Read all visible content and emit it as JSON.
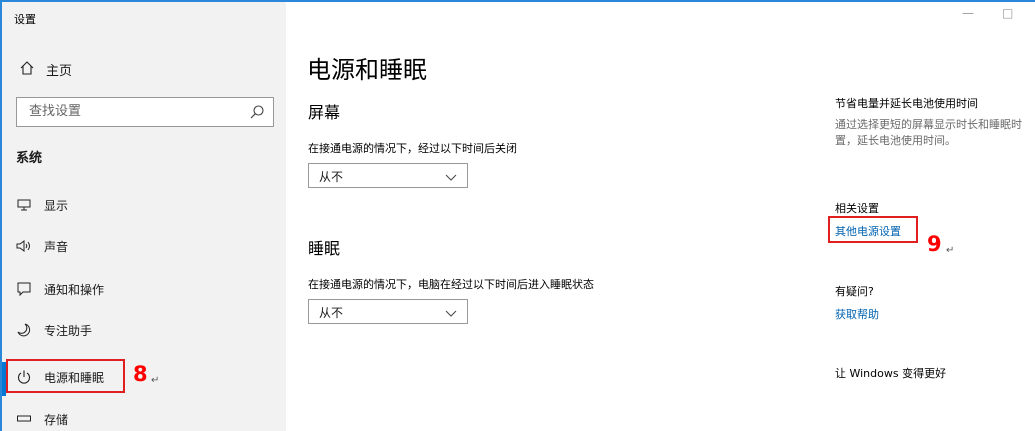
{
  "window": {
    "title": "设置",
    "minimize_glyph": "—",
    "maximize_glyph": "□"
  },
  "sidebar": {
    "home_label": "主页",
    "search_placeholder": "查找设置",
    "section_label": "系统",
    "items": [
      {
        "label": "显示",
        "icon": "monitor-icon"
      },
      {
        "label": "声音",
        "icon": "speaker-icon"
      },
      {
        "label": "通知和操作",
        "icon": "notification-icon"
      },
      {
        "label": "专注助手",
        "icon": "moon-icon"
      },
      {
        "label": "电源和睡眠",
        "icon": "power-icon",
        "selected": true
      },
      {
        "label": "存储",
        "icon": "storage-icon"
      }
    ]
  },
  "annotations": {
    "label_8": "8",
    "label_9": "9",
    "return_mark": "↵"
  },
  "main": {
    "title": "电源和睡眠",
    "screen": {
      "heading": "屏幕",
      "desc": "在接通电源的情况下，经过以下时间后关闭",
      "value": "从不"
    },
    "sleep": {
      "heading": "睡眠",
      "desc": "在接通电源的情况下，电脑在经过以下时间后进入睡眠状态",
      "value": "从不"
    }
  },
  "right": {
    "battery_title": "节省电量并延长电池使用时间",
    "battery_text_line1": "通过选择更短的屏幕显示时长和睡眠时",
    "battery_text_line2": "置，延长电池使用时间。",
    "related_title": "相关设置",
    "related_link": "其他电源设置",
    "question_title": "有疑问?",
    "help_link": "获取帮助",
    "improve_title": "让 Windows 变得更好"
  },
  "colors": {
    "accent": "#0078d4",
    "link": "#0063b1",
    "annotation": "#e02020"
  }
}
